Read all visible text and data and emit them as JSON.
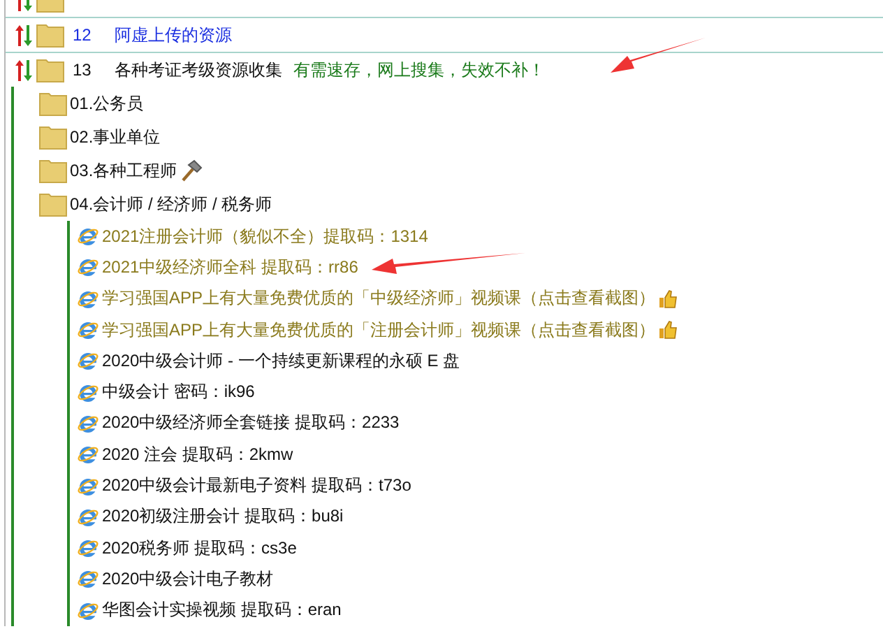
{
  "tree": [
    {
      "kind": "plain"
    },
    {
      "number": "12",
      "title": "阿虚上传的资源",
      "kind": "link"
    },
    {
      "number": "13",
      "title": "各种考证考级资源收集",
      "note": "有需速存，网上搜集，失效不补！",
      "kind": "plain",
      "children": [
        {
          "title": "01.公务员",
          "kind": "plain"
        },
        {
          "title": "02.事业单位",
          "kind": "plain"
        },
        {
          "title": "03.各种工程师",
          "kind": "hammer"
        },
        {
          "title": "04.会计师 / 经济师 / 税务师",
          "kind": "plain",
          "links": [
            {
              "title": "2021注册会计师（貌似不全）提取码：1314",
              "visited": true,
              "kind": "plain"
            },
            {
              "title": "2021中级经济师全科 提取码：rr86",
              "visited": true,
              "kind": "plain"
            },
            {
              "title": "学习强国APP上有大量免费优质的「中级经济师」视频课（点击查看截图）",
              "visited": true,
              "kind": "thumb"
            },
            {
              "title": "学习强国APP上有大量免费优质的「注册会计师」视频课（点击查看截图）",
              "visited": true,
              "kind": "thumb"
            },
            {
              "title": "2020中级会计师 - 一个持续更新课程的永硕 E 盘",
              "visited": false,
              "kind": "plain"
            },
            {
              "title": "中级会计 密码：ik96",
              "visited": false,
              "kind": "plain"
            },
            {
              "title": "2020中级经济师全套链接 提取码：2233",
              "visited": false,
              "kind": "plain"
            },
            {
              "title": "2020 注会 提取码：2kmw",
              "visited": false,
              "kind": "plain"
            },
            {
              "title": "2020中级会计最新电子资料 提取码：t73o",
              "visited": false,
              "kind": "plain"
            },
            {
              "title": "2020初级注册会计 提取码：bu8i",
              "visited": false,
              "kind": "plain"
            },
            {
              "title": "2020税务师 提取码：cs3e",
              "visited": false,
              "kind": "plain"
            },
            {
              "title": "2020中级会计电子教材",
              "visited": false,
              "kind": "plain"
            },
            {
              "title": "华图会计实操视频 提取码：eran",
              "visited": false,
              "kind": "plain"
            }
          ]
        }
      ]
    }
  ],
  "annotations": [
    {
      "kind": "arrow"
    },
    {
      "kind": "arrow"
    }
  ]
}
